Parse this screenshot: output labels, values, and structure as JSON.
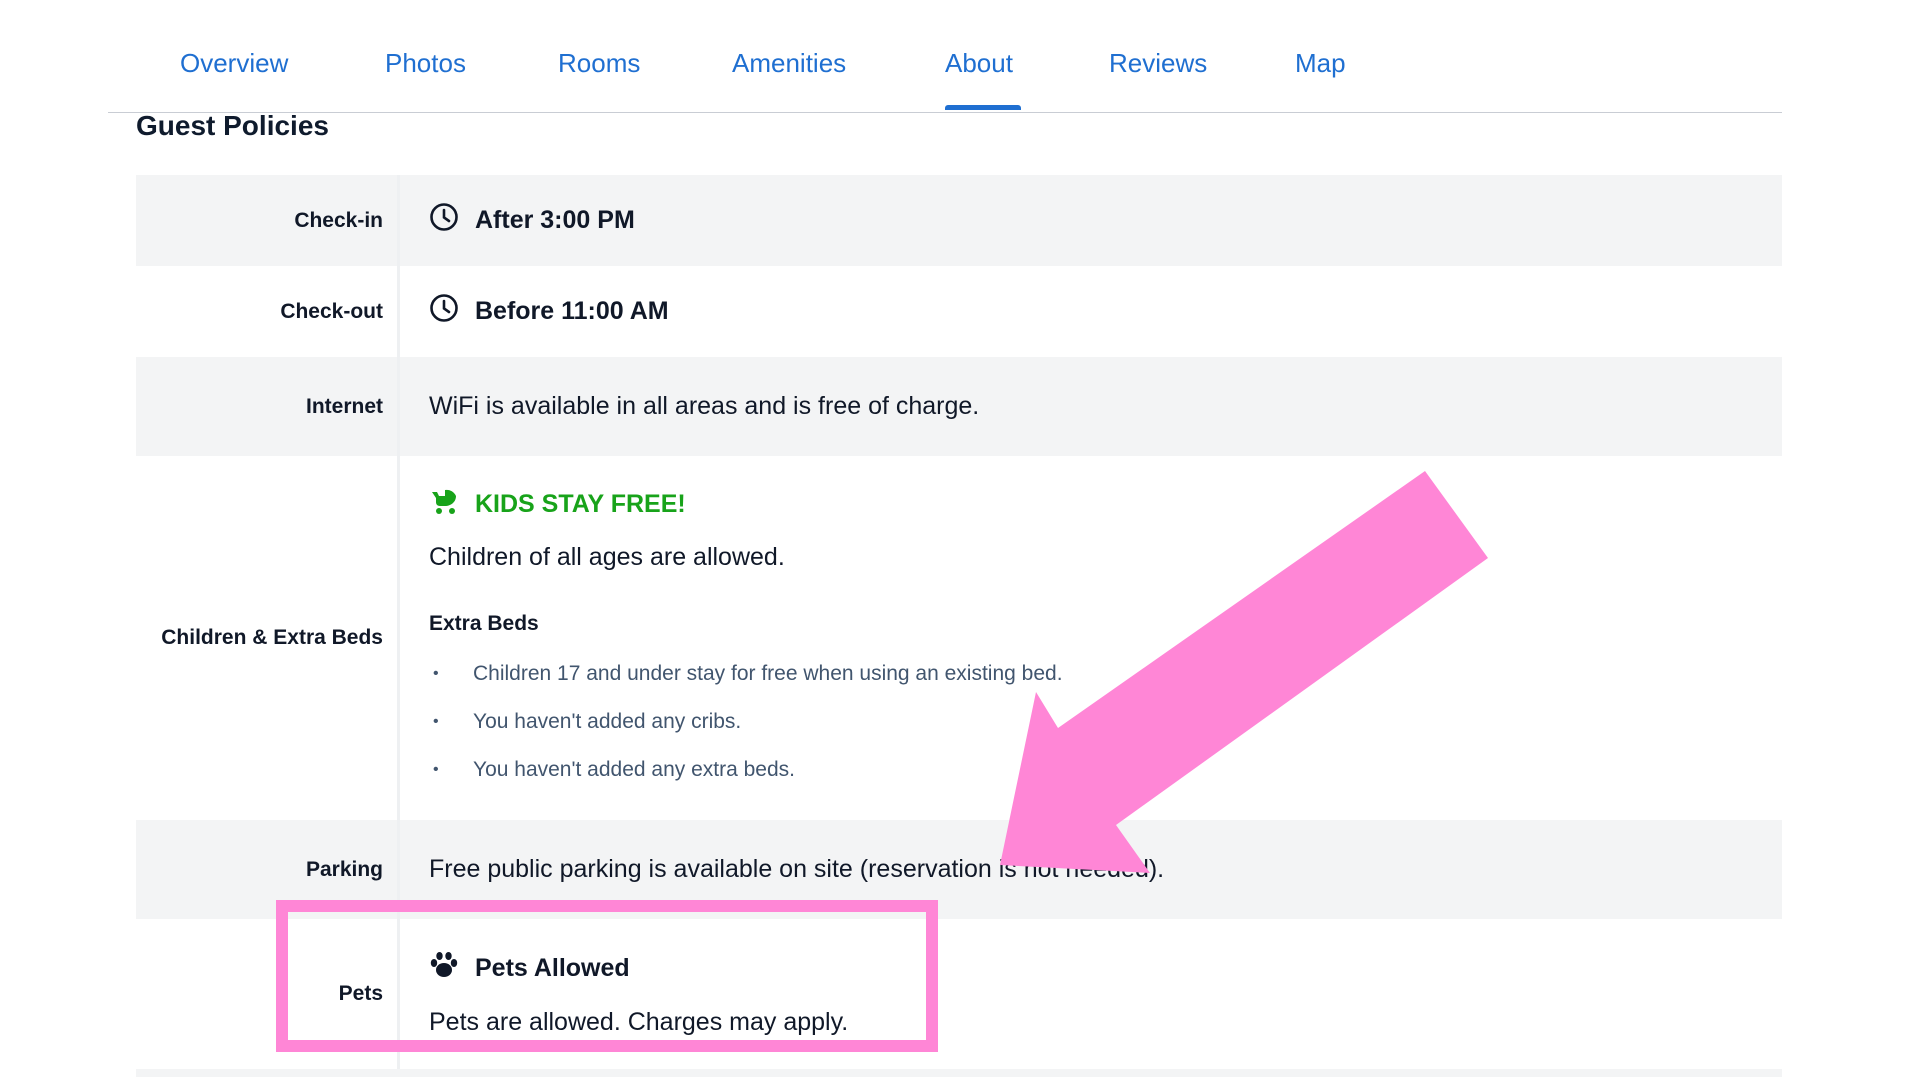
{
  "tabs": [
    {
      "label": "Overview"
    },
    {
      "label": "Photos"
    },
    {
      "label": "Rooms"
    },
    {
      "label": "Amenities"
    },
    {
      "label": "About",
      "active": true
    },
    {
      "label": "Reviews"
    },
    {
      "label": "Map"
    }
  ],
  "section_title": "Guest Policies",
  "policies": {
    "checkin": {
      "label": "Check-in",
      "value": "After 3:00 PM",
      "icon": "clock-icon"
    },
    "checkout": {
      "label": "Check-out",
      "value": "Before 11:00 AM",
      "icon": "clock-icon"
    },
    "internet": {
      "label": "Internet",
      "value": "WiFi is available in all areas and is free of charge."
    },
    "children": {
      "label": "Children & Extra Beds",
      "badge": "KIDS STAY FREE!",
      "badge_icon": "stroller-icon",
      "text": "Children of all ages are allowed.",
      "extra_beds_title": "Extra Beds",
      "bullets": [
        "Children 17 and under stay for free when using an existing bed.",
        "You haven't added any cribs.",
        "You haven't added any extra beds."
      ]
    },
    "parking": {
      "label": "Parking",
      "value": "Free public parking is available on site (reservation is not needed)."
    },
    "pets": {
      "label": "Pets",
      "title": "Pets Allowed",
      "title_icon": "paw-icon",
      "text": "Pets are allowed. Charges may apply."
    }
  },
  "colors": {
    "accent": "#1f6fd1",
    "green": "#18a31a",
    "highlight": "#ff86d6",
    "row_shade": "#f3f4f5"
  }
}
